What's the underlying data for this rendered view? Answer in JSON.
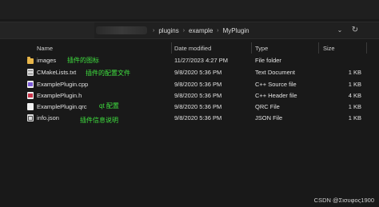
{
  "breadcrumb": {
    "items": [
      "plugins",
      "example",
      "MyPlugin"
    ],
    "separator": "›"
  },
  "columns": {
    "name": "Name",
    "date_modified": "Date modified",
    "type": "Type",
    "size": "Size"
  },
  "files": [
    {
      "name": "images",
      "date": "11/27/2023 4:27 PM",
      "type": "File folder",
      "size": "",
      "icon": "folder-icon"
    },
    {
      "name": "CMakeLists.txt",
      "date": "9/8/2020 5:36 PM",
      "type": "Text Document",
      "size": "1 KB",
      "icon": "text-file-icon"
    },
    {
      "name": "ExamplePlugin.cpp",
      "date": "9/8/2020 5:36 PM",
      "type": "C++ Source file",
      "size": "1 KB",
      "icon": "cpp-file-icon"
    },
    {
      "name": "ExamplePlugin.h",
      "date": "9/8/2020 5:36 PM",
      "type": "C++ Header file",
      "size": "4 KB",
      "icon": "header-file-icon"
    },
    {
      "name": "ExamplePlugin.qrc",
      "date": "9/8/2020 5:36 PM",
      "type": "QRC File",
      "size": "1 KB",
      "icon": "qrc-file-icon"
    },
    {
      "name": "info.json",
      "date": "9/8/2020 5:36 PM",
      "type": "JSON File",
      "size": "1 KB",
      "icon": "json-file-icon"
    }
  ],
  "annotations": {
    "images": "插件的图标",
    "cmake": "插件的配置文件",
    "qrc": "qt 配置",
    "json": "插件信息说明"
  },
  "watermark": "CSDN @Σισυφος1900",
  "colors": {
    "background": "#191919",
    "annotation": "#3fe03f",
    "folder": "#e8b64a"
  }
}
